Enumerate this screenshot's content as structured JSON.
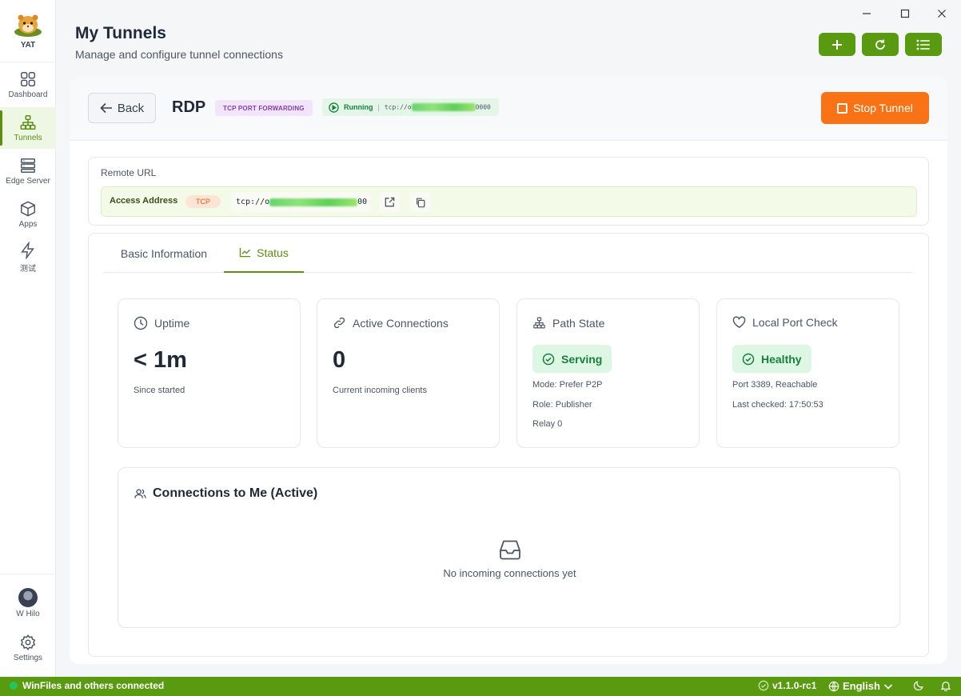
{
  "app": {
    "logo_text": "YAT"
  },
  "sidebar": {
    "items": [
      {
        "label": "Dashboard",
        "icon": "grid-icon"
      },
      {
        "label": "Tunnels",
        "icon": "network-icon"
      },
      {
        "label": "Edge Server",
        "icon": "server-icon"
      },
      {
        "label": "Apps",
        "icon": "cube-icon"
      },
      {
        "label": "测试",
        "icon": "lightning-icon"
      }
    ],
    "user_name": "W Hilo",
    "settings_label": "Settings"
  },
  "header": {
    "title": "My Tunnels",
    "subtitle": "Manage and configure tunnel connections",
    "buttons": [
      "plus-icon",
      "refresh-icon",
      "list-icon"
    ]
  },
  "window_controls": [
    "minimize-icon",
    "maximize-icon",
    "close-icon"
  ],
  "tunnel": {
    "back_label": "Back",
    "name": "RDP",
    "type": "TCP PORT FORWARDING",
    "status": "Running",
    "status_url_prefix": "tcp://o",
    "status_url_suffix": "0000",
    "stop_label": "Stop Tunnel"
  },
  "remote": {
    "label": "Remote URL",
    "access_label": "Access Address",
    "protocol": "TCP",
    "url_prefix": "tcp://o",
    "url_suffix": "00"
  },
  "tabs": [
    {
      "label": "Basic Information",
      "active": false
    },
    {
      "label": "Status",
      "active": true
    }
  ],
  "stats": {
    "uptime": {
      "title": "Uptime",
      "value": "< 1m",
      "sub": "Since started"
    },
    "active": {
      "title": "Active Connections",
      "value": "0",
      "sub": "Current incoming clients"
    },
    "path": {
      "title": "Path State",
      "state": "Serving",
      "details": [
        "Mode: Prefer P2P",
        "Role: Publisher",
        "Relay 0"
      ]
    },
    "port": {
      "title": "Local Port Check",
      "state": "Healthy",
      "details": [
        "Port 3389, Reachable",
        "Last checked: 17:50:53"
      ]
    }
  },
  "connections": {
    "title": "Connections to Me (Active)",
    "empty": "No incoming connections yet"
  },
  "statusbar": {
    "message": "WinFiles and others connected",
    "version": "v1.1.0-rc1",
    "language": "English"
  },
  "colors": {
    "brand": "#5a9a10",
    "accent_text": "#5a8f13",
    "stop": "#f97316",
    "success": "#17803d"
  }
}
